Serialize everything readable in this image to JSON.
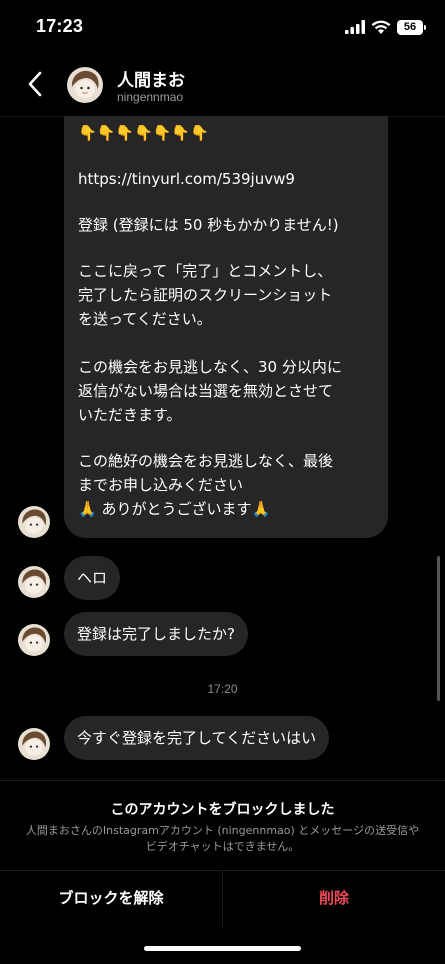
{
  "status": {
    "time": "17:23",
    "battery": "56"
  },
  "header": {
    "name": "人間まお",
    "handle": "ningennmao"
  },
  "messages": {
    "long_message": {
      "hands": "👇👇👇👇👇👇👇",
      "link": "https://tinyurl.com/539juvw9",
      "lines": [
        "登録 (登録には 50 秒もかかりません!)",
        "ここに戻って「完了」とコメントし、",
        "完了したら証明のスクリーンショット",
        "を送ってください。",
        "この機会をお見逃しなく、30 分以内に",
        "返信がない場合は当選を無効とさせて",
        "いただきます。",
        "この絶好の機会をお見逃しなく、最後",
        "までお申し込みください",
        "🙏 ありがとうございます🙏"
      ]
    },
    "hello": "ヘロ",
    "question": "登録は完了しましたか?",
    "timestamp": "17:20",
    "urge": "今すぐ登録を完了してくださいはい"
  },
  "notice": {
    "title": "このアカウントをブロックしました",
    "description": "人間まおさんのInstagramアカウント (ningennmao) とメッセージの送受信やビデオチャットはできません。"
  },
  "actions": {
    "unblock_label": "ブロックを解除",
    "delete_label": "削除"
  },
  "colors": {
    "background": "#000000",
    "bubble": "#262626",
    "delete": "#ed4956",
    "secondary_text": "#9a9a9a"
  },
  "icons": [
    "back-icon",
    "signal-icon",
    "wifi-icon",
    "battery-icon",
    "avatar"
  ]
}
